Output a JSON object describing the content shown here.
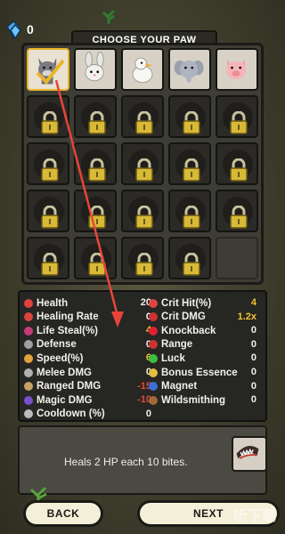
{
  "top_bar": {
    "gem_count": "0",
    "title": "CHOOSE YOUR PAW"
  },
  "pets": {
    "unlocked": [
      "wolf",
      "rabbit",
      "duck",
      "elephant",
      "pig"
    ],
    "selected": "wolf"
  },
  "stats_left": [
    {
      "label": "Health",
      "value": "20",
      "color": "white",
      "icon": "heart-icon"
    },
    {
      "label": "Healing Rate",
      "value": "0",
      "color": "white",
      "icon": "cross-icon"
    },
    {
      "label": "Life Steal(%)",
      "value": "4",
      "color": "yellow",
      "icon": "drop-icon"
    },
    {
      "label": "Defense",
      "value": "0",
      "color": "white",
      "icon": "shield-icon"
    },
    {
      "label": "Speed(%)",
      "value": "6",
      "color": "yellow",
      "icon": "boot-icon"
    },
    {
      "label": "Melee DMG",
      "value": "0",
      "color": "white",
      "icon": "sword-icon"
    },
    {
      "label": "Ranged DMG",
      "value": "-15",
      "color": "red",
      "icon": "arrow-icon"
    },
    {
      "label": "Magic DMG",
      "value": "-10",
      "color": "red",
      "icon": "magic-icon"
    },
    {
      "label": "Cooldown (%)",
      "value": "0",
      "color": "white",
      "icon": "clock-icon"
    }
  ],
  "stats_right": [
    {
      "label": "Crit Hit(%)",
      "value": "4",
      "color": "yellow",
      "icon": "crit-icon"
    },
    {
      "label": "Crit DMG",
      "value": "1.2x",
      "color": "yellow",
      "icon": "bomb-icon"
    },
    {
      "label": "Knockback",
      "value": "0",
      "color": "white",
      "icon": "fist-icon"
    },
    {
      "label": "Range",
      "value": "0",
      "color": "white",
      "icon": "target-icon"
    },
    {
      "label": "Luck",
      "value": "0",
      "color": "white",
      "icon": "clover-icon"
    },
    {
      "label": "Bonus Essence",
      "value": "0",
      "color": "white",
      "icon": "essence-icon"
    },
    {
      "label": "Magnet",
      "value": "0",
      "color": "white",
      "icon": "magnet-icon"
    },
    {
      "label": "Wildsmithing",
      "value": "0",
      "color": "white",
      "icon": "hammer-icon"
    }
  ],
  "description": {
    "text": "Heals 2 HP each 10 bites."
  },
  "buttons": {
    "back": "BACK",
    "next": "NEXT"
  },
  "watermark": "听下载"
}
